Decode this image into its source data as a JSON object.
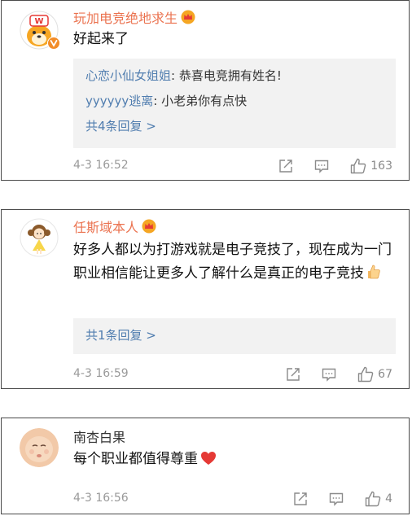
{
  "comments": [
    {
      "username": "玩加电竞绝地求生",
      "text": "好起来了",
      "replies": [
        {
          "user": "心恋小仙女姐姐",
          "text": ": 恭喜电竞拥有姓名!"
        },
        {
          "user": "yyyyyy逃离",
          "text": ": 小老弟你有点快"
        }
      ],
      "more_replies": "共4条回复 >",
      "time": "4-3 16:52",
      "likes": "163"
    },
    {
      "username": "任斯域本人",
      "text": "好多人都以为打游戏就是电子竞技了，现在成为一门职业相信能让更多人了解什么是真正的电子竞技",
      "more_replies": "共1条回复 >",
      "time": "4-3 16:59",
      "likes": "67"
    },
    {
      "username": "南杏白果",
      "text": "每个职业都值得尊重",
      "time": "4-3 16:56",
      "likes": "4"
    }
  ],
  "icons": {
    "crown": "crown-icon",
    "verified": "verified-badge-icon",
    "share": "share-icon",
    "comment": "comment-icon",
    "like": "thumbs-up-icon",
    "thumbs_emoji": "thumbs-up-emoji",
    "heart_emoji": "heart-emoji"
  },
  "colors": {
    "orange_name": "#eb7350",
    "link_blue": "#507daf",
    "reply_bg": "#f2f2f2",
    "timestamp": "#9a9a9a",
    "heart": "#e53935"
  }
}
